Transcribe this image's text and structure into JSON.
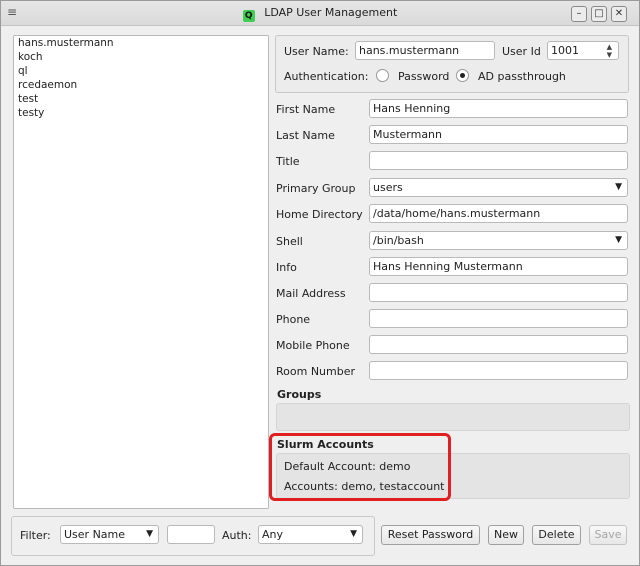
{
  "window": {
    "title": "LDAP User Management",
    "icon": "qt-logo-icon"
  },
  "users": [
    "hans.mustermann",
    "koch",
    "ql",
    "rcedaemon",
    "test",
    "testy"
  ],
  "header": {
    "user_name_label": "User Name:",
    "user_name_value": "hans.mustermann",
    "user_id_label": "User Id",
    "user_id_value": "1001",
    "auth_label": "Authentication:",
    "auth_password": "Password",
    "auth_ad": "AD passthrough",
    "auth_selected": "AD passthrough"
  },
  "form": {
    "first_name": {
      "label": "First Name",
      "value": "Hans Henning"
    },
    "last_name": {
      "label": "Last Name",
      "value": "Mustermann"
    },
    "title": {
      "label": "Title",
      "value": ""
    },
    "primary_group": {
      "label": "Primary Group",
      "value": "users"
    },
    "home_directory": {
      "label": "Home Directory",
      "value": "/data/home/hans.mustermann"
    },
    "shell": {
      "label": "Shell",
      "value": "/bin/bash"
    },
    "info": {
      "label": "Info",
      "value": "Hans Henning Mustermann"
    },
    "mail_address": {
      "label": "Mail Address",
      "value": ""
    },
    "phone": {
      "label": "Phone",
      "value": ""
    },
    "mobile_phone": {
      "label": "Mobile Phone",
      "value": ""
    },
    "room_number": {
      "label": "Room Number",
      "value": ""
    }
  },
  "groups": {
    "title": "Groups"
  },
  "slurm": {
    "title": "Slurm Accounts",
    "default_account": "Default Account: demo",
    "accounts": "Accounts: demo, testaccount"
  },
  "filter": {
    "label": "Filter:",
    "field_value": "User Name",
    "text_value": "",
    "auth_label": "Auth:",
    "auth_value": "Any"
  },
  "buttons": {
    "reset_password": "Reset Password",
    "new": "New",
    "delete": "Delete",
    "save": "Save"
  },
  "colors": {
    "highlight": "#e02020",
    "qt_green": "#41cd52"
  }
}
